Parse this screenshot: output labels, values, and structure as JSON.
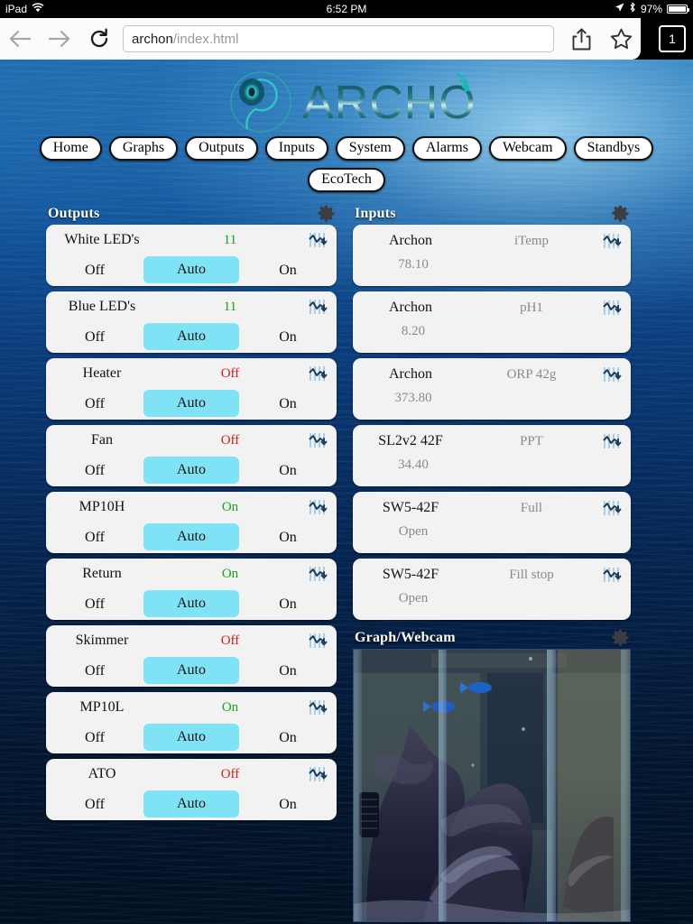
{
  "status_bar": {
    "device": "iPad",
    "wifi_icon": "wifi-icon",
    "time": "6:52 PM",
    "location_icon": "location-arrow-icon",
    "bluetooth_icon": "bluetooth-icon",
    "battery_percent": "97%"
  },
  "browser": {
    "back_icon": "back-arrow-icon",
    "forward_icon": "forward-arrow-icon",
    "reload_icon": "reload-icon",
    "url_host": "archon",
    "url_path": "/index.html",
    "share_icon": "share-icon",
    "bookmark_icon": "star-icon",
    "tab_count": "1"
  },
  "site": {
    "logo_text": "ARCHON",
    "nav_primary": [
      "Home",
      "Graphs",
      "Outputs",
      "Inputs",
      "System",
      "Alarms",
      "Webcam",
      "Standbys"
    ],
    "nav_secondary": [
      "EcoTech"
    ]
  },
  "outputs": {
    "title": "Outputs",
    "gear_icon": "gear-icon",
    "segments": {
      "off": "Off",
      "auto": "Auto",
      "on": "On"
    },
    "rows": [
      {
        "name": "White LED's",
        "state": "11",
        "state_type": "num",
        "selected": "Auto",
        "chart_icon": "chart-icon"
      },
      {
        "name": "Blue LED's",
        "state": "11",
        "state_type": "num",
        "selected": "Auto",
        "chart_icon": "chart-icon"
      },
      {
        "name": "Heater",
        "state": "Off",
        "state_type": "off",
        "selected": "Auto",
        "chart_icon": "chart-icon"
      },
      {
        "name": "Fan",
        "state": "Off",
        "state_type": "off",
        "selected": "Auto",
        "chart_icon": "chart-icon"
      },
      {
        "name": "MP10H",
        "state": "On",
        "state_type": "on",
        "selected": "Auto",
        "chart_icon": "chart-icon"
      },
      {
        "name": "Return",
        "state": "On",
        "state_type": "on",
        "selected": "Auto",
        "chart_icon": "chart-icon"
      },
      {
        "name": "Skimmer",
        "state": "Off",
        "state_type": "off",
        "selected": "Auto",
        "chart_icon": "chart-icon"
      },
      {
        "name": "MP10L",
        "state": "On",
        "state_type": "on",
        "selected": "Auto",
        "chart_icon": "chart-icon"
      },
      {
        "name": "ATO",
        "state": "Off",
        "state_type": "off",
        "selected": "Auto",
        "chart_icon": "chart-icon"
      }
    ]
  },
  "inputs": {
    "title": "Inputs",
    "gear_icon": "gear-icon",
    "rows": [
      {
        "device": "Archon",
        "label": "iTemp",
        "value": "78.10",
        "chart_icon": "chart-icon"
      },
      {
        "device": "Archon",
        "label": "pH1",
        "value": "8.20",
        "chart_icon": "chart-icon"
      },
      {
        "device": "Archon",
        "label": "ORP 42g",
        "value": "373.80",
        "chart_icon": "chart-icon"
      },
      {
        "device": "SL2v2 42F",
        "label": "PPT",
        "value": "34.40",
        "chart_icon": "chart-icon"
      },
      {
        "device": "SW5-42F",
        "label": "Full",
        "value": "Open",
        "chart_icon": "chart-icon"
      },
      {
        "device": "SW5-42F",
        "label": "Fill stop",
        "value": "Open",
        "chart_icon": "chart-icon"
      }
    ]
  },
  "webcam": {
    "title": "Graph/Webcam",
    "gear_icon": "gear-icon",
    "image_alt": "aquarium-webcam-live-view"
  },
  "colors": {
    "accent_cyan": "#7fe3f5",
    "status_on": "#17a317",
    "status_off": "#d41b1b",
    "panel_bg": "#f2f2f2",
    "muted_text": "#8a8a8a"
  }
}
